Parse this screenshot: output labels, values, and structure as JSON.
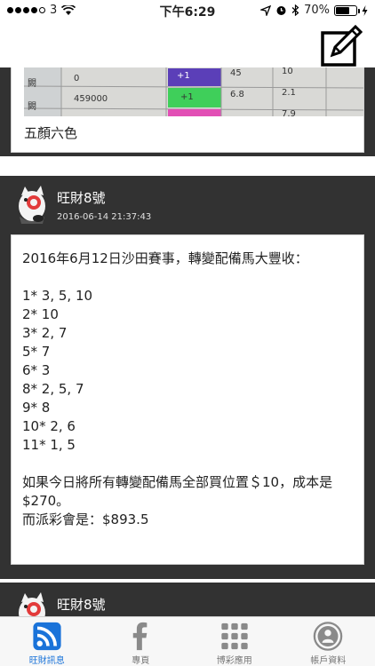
{
  "status_bar": {
    "carrier": "3",
    "time": "下午6:29",
    "battery": "70%",
    "battery_level": 0.7
  },
  "header": {
    "compose_icon": "compose-icon"
  },
  "feed": {
    "partial_post": {
      "photo_values": [
        "0",
        "459000",
        "+1",
        "+1",
        "45",
        "10",
        "6.8",
        "2.1",
        "7.9"
      ],
      "caption": "五顏六色"
    },
    "posts": [
      {
        "username": "旺財8號",
        "timestamp": "2016-06-14 21:37:43",
        "text": "2016年6月12日沙田賽事，轉變配備馬大豐收：\n\n1* 3, 5, 10\n2* 10\n3* 2, 7\n5* 7\n6* 3\n8* 2, 5, 7\n9* 8\n10* 2, 6\n11* 1, 5\n\n如果今日將所有轉變配備馬全部買位置＄10，成本是$270。\n而派彩會是：$893.5"
      },
      {
        "username": "旺財8號",
        "timestamp": "",
        "text": ""
      }
    ]
  },
  "tab_bar": {
    "tabs": [
      {
        "label": "旺財訊息",
        "icon": "wifi-feed-icon",
        "active": true
      },
      {
        "label": "專頁",
        "icon": "facebook-icon",
        "active": false
      },
      {
        "label": "博彩應用",
        "icon": "grid-apps-icon",
        "active": false
      },
      {
        "label": "帳戶資料",
        "icon": "account-icon",
        "active": false
      }
    ]
  },
  "colors": {
    "accent": "#1a73d9",
    "post_header_bg": "#323232",
    "tab_inactive": "#777777"
  }
}
